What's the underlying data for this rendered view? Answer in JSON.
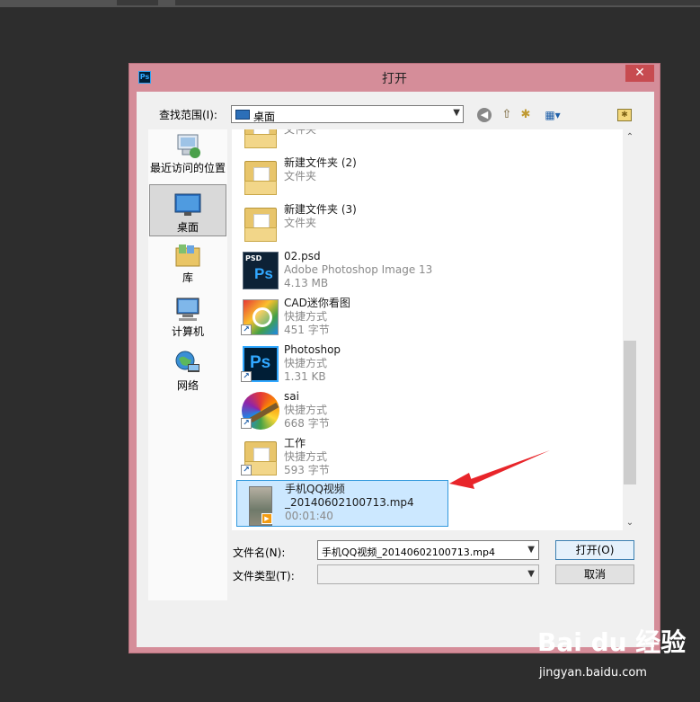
{
  "dialog": {
    "title": "打开",
    "app_badge": "Ps",
    "close_glyph": "✕"
  },
  "toolbar": {
    "look_in_label": "查找范围(I):",
    "look_in_value": "桌面",
    "back_icon": "◀",
    "up_icon": "⇧",
    "new_folder_icon": "✱",
    "view_menu_icon": "▦▾",
    "extra_icon": "✱"
  },
  "places": [
    {
      "label": "最近访问的位置",
      "icon": "recent-places-icon"
    },
    {
      "label": "桌面",
      "icon": "desktop-icon",
      "selected": true
    },
    {
      "label": "库",
      "icon": "libraries-icon"
    },
    {
      "label": "计算机",
      "icon": "computer-icon"
    },
    {
      "label": "网络",
      "icon": "network-icon"
    }
  ],
  "files": [
    {
      "name": "",
      "type": "文件夹",
      "icon": "folder-icon"
    },
    {
      "name": "新建文件夹 (2)",
      "type": "文件夹",
      "icon": "folder-icon"
    },
    {
      "name": "新建文件夹 (3)",
      "type": "文件夹",
      "icon": "folder-icon"
    },
    {
      "name": "02.psd",
      "type": "Adobe Photoshop Image 13",
      "size": "4.13 MB",
      "icon": "psd-file-icon"
    },
    {
      "name": "CAD迷你看图",
      "type": "快捷方式",
      "size": "451 字节",
      "icon": "cad-viewer-icon"
    },
    {
      "name": "Photoshop",
      "type": "快捷方式",
      "size": "1.31 KB",
      "icon": "photoshop-icon"
    },
    {
      "name": "sai",
      "type": "快捷方式",
      "size": "668 字节",
      "icon": "sai-icon"
    },
    {
      "name": "工作",
      "type": "快捷方式",
      "size": "593 字节",
      "icon": "folder-shortcut-icon"
    },
    {
      "name": "手机QQ视频",
      "name_line2": "_20140602100713.mp4",
      "size": "00:01:40",
      "icon": "video-file-icon",
      "selected": true
    }
  ],
  "footer": {
    "file_name_label": "文件名(N):",
    "file_name_value": "手机QQ视频_20140602100713.mp4",
    "file_type_label": "文件类型(T):",
    "file_type_value": "",
    "open_button": "打开(O)",
    "cancel_button": "取消"
  },
  "scroll": {
    "up": "⌃",
    "down": "⌄"
  },
  "watermark": {
    "top": "Bai du 经验",
    "bottom": "jingyan.baidu.com"
  },
  "colors": {
    "dialog_frame": "#d58d99",
    "selection_fill": "#cce8ff",
    "selection_border": "#3399dd",
    "annotation_arrow": "#e8252a"
  }
}
